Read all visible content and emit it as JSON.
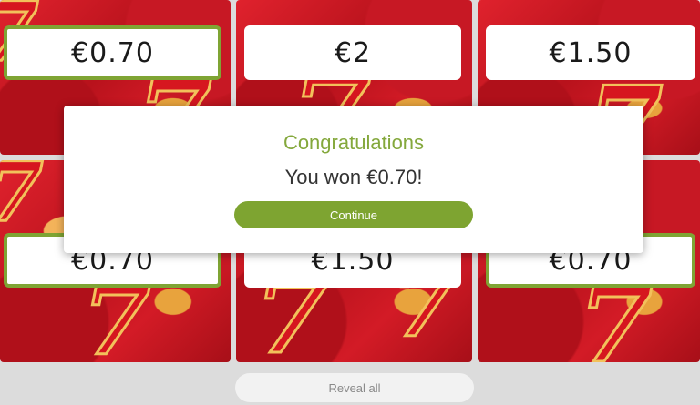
{
  "tiles": [
    {
      "prize": "€0.70",
      "winning": true
    },
    {
      "prize": "€2",
      "winning": false
    },
    {
      "prize": "€1.50",
      "winning": false
    },
    {
      "prize": "€0.70",
      "winning": true
    },
    {
      "prize": "€1.50",
      "winning": false
    },
    {
      "prize": "€0.70",
      "winning": true
    }
  ],
  "dialog": {
    "title": "Congratulations",
    "message": "You won €0.70!",
    "continue_label": "Continue"
  },
  "footer": {
    "reveal_label": "Reveal all"
  },
  "colors": {
    "accent": "#7ea431",
    "win_border": "#7fa434",
    "tile_red": "#d31b26",
    "tile_gold": "#f2c15b"
  }
}
